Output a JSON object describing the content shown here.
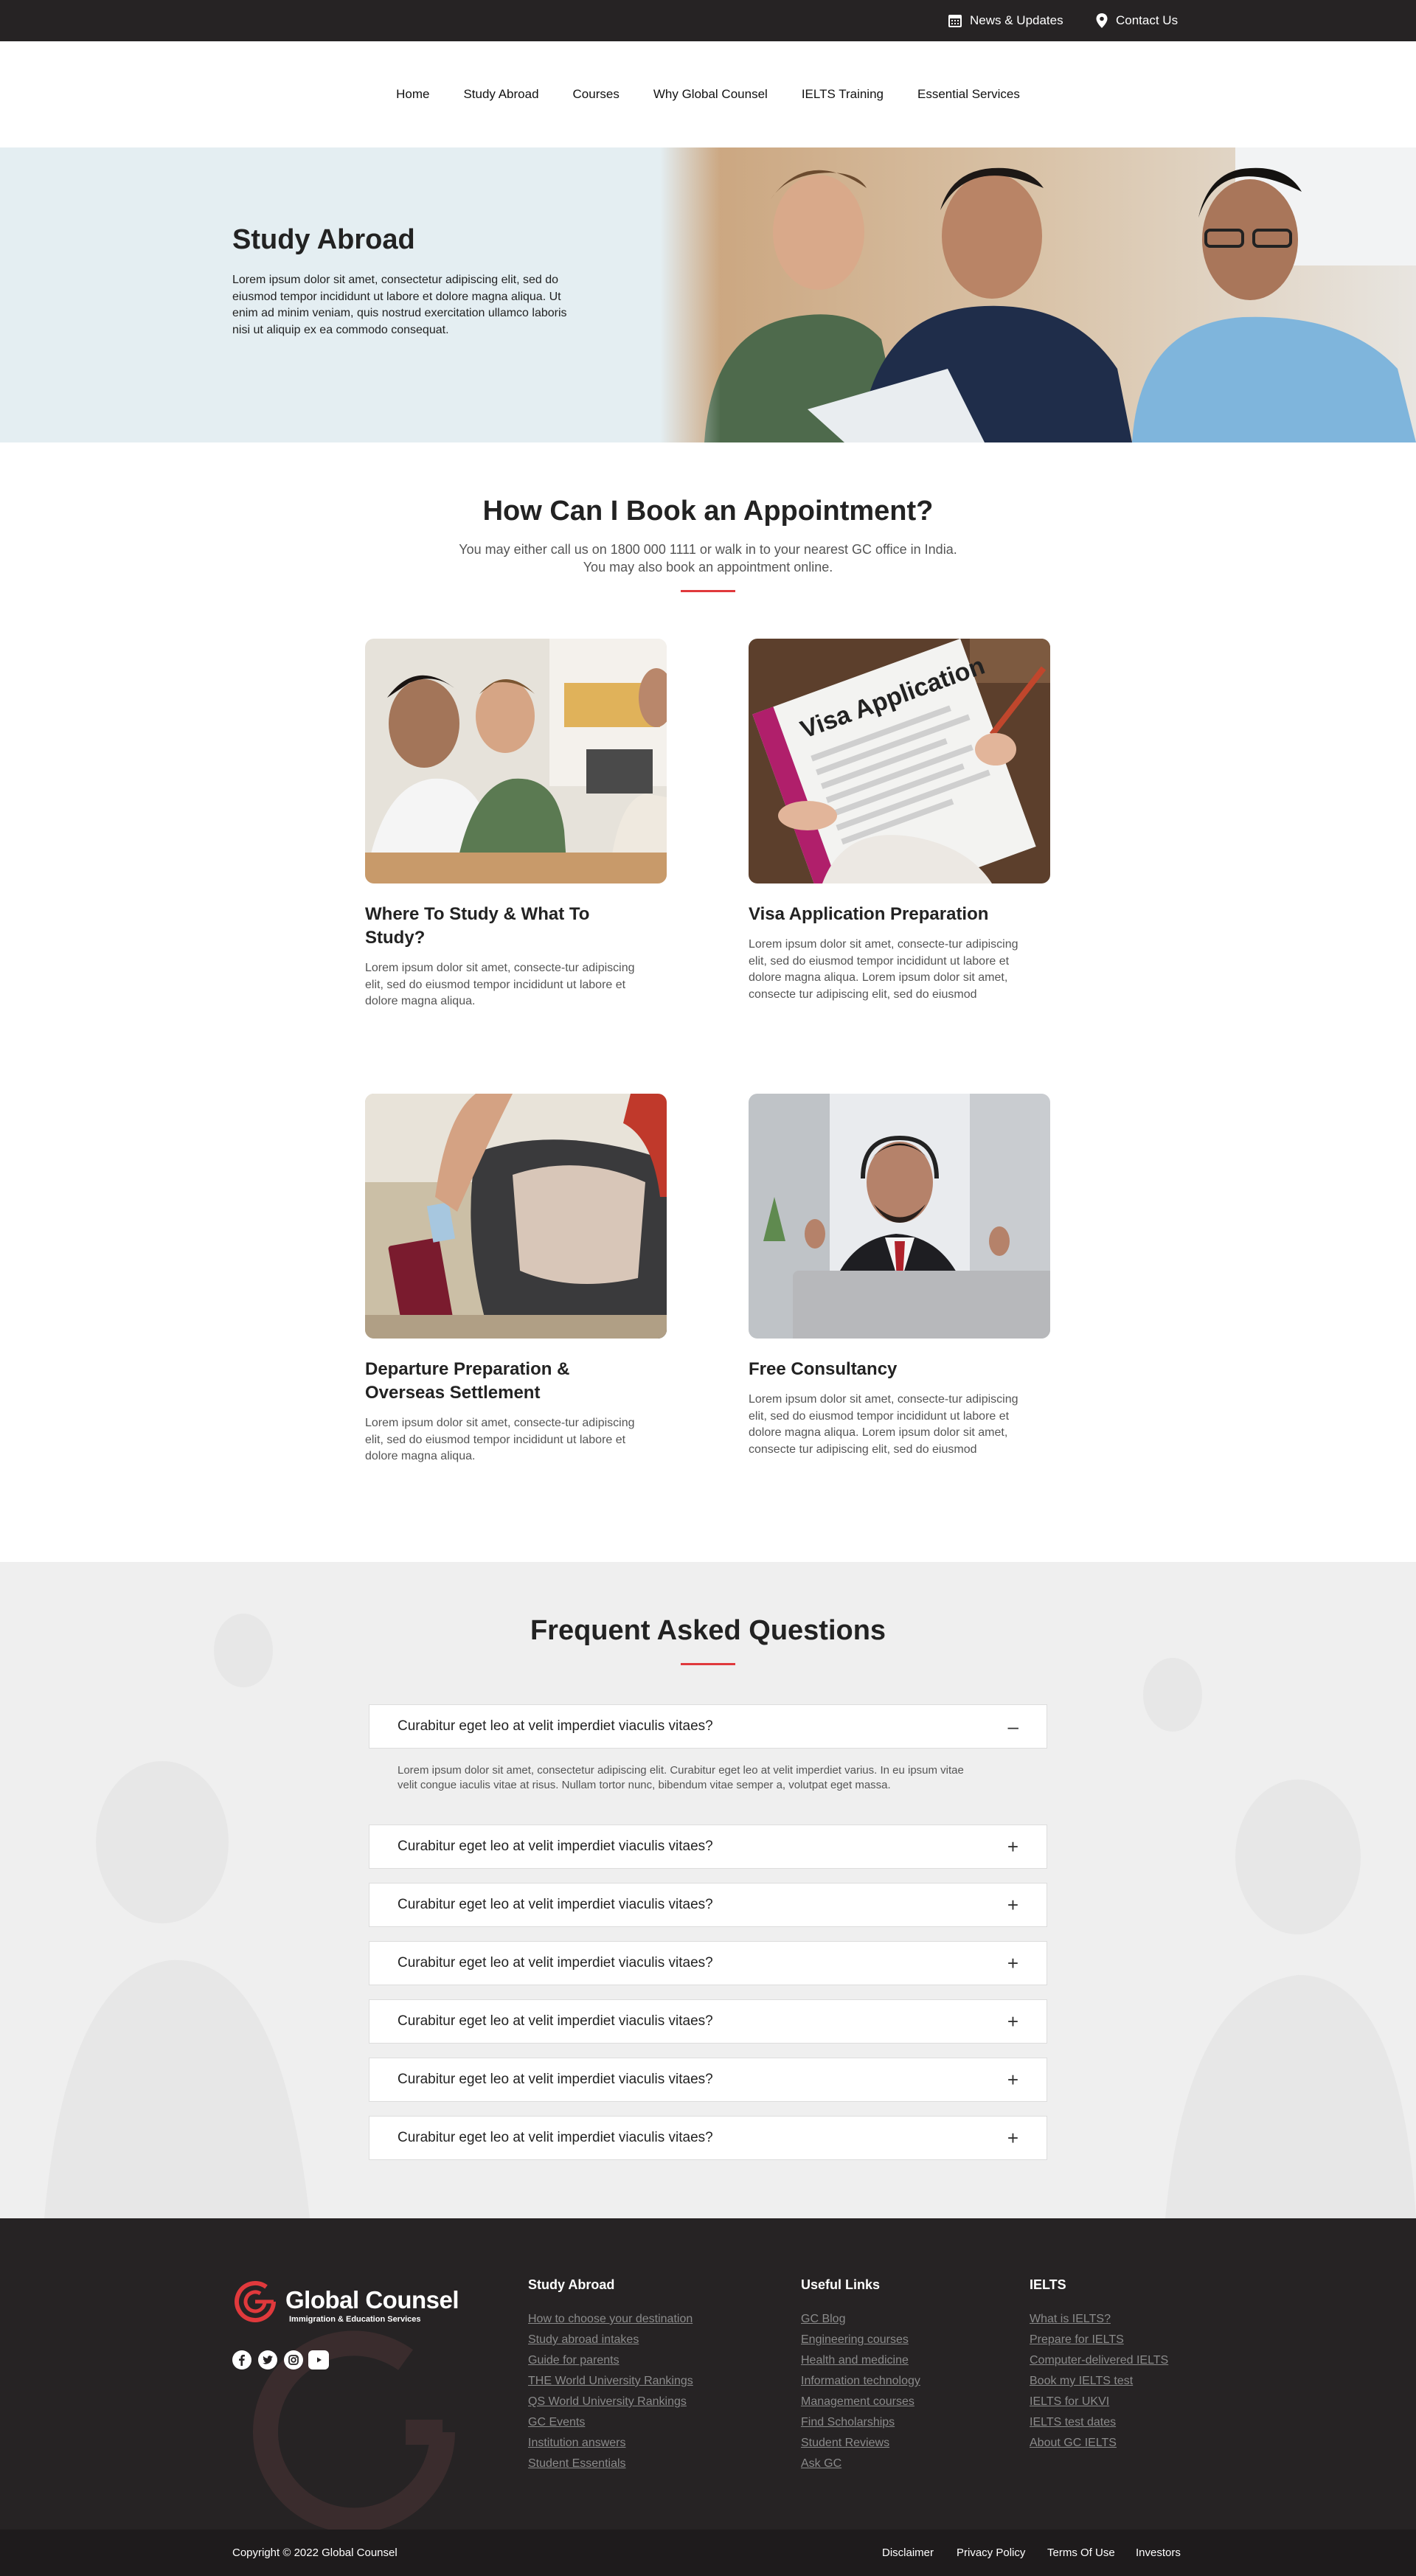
{
  "topbar": {
    "news": "News & Updates",
    "contact": "Contact Us"
  },
  "nav": [
    "Home",
    "Study Abroad",
    "Courses",
    "Why Global Counsel",
    "IELTS Training",
    "Essential Services"
  ],
  "hero": {
    "title": "Study Abroad",
    "text": "Lorem ipsum dolor sit amet, consectetur adipiscing elit, sed do eiusmod tempor incididunt ut labore et dolore magna aliqua. Ut enim ad minim veniam, quis nostrud exercitation ullamco laboris nisi ut aliquip ex ea commodo consequat."
  },
  "booking": {
    "title": "How Can I Book an Appointment?",
    "subtitle": "You may either call us on 1800 000 1111 or walk in to your nearest GC office in India. You may also book an appointment online."
  },
  "cards": [
    {
      "title": "Where To Study & What To Study?",
      "text": "Lorem ipsum dolor sit amet, consecte-tur adipiscing elit, sed do eiusmod tempor incididunt ut labore et dolore magna aliqua."
    },
    {
      "title": "Visa Application Preparation",
      "text": "Lorem ipsum dolor sit amet, consecte-tur adipiscing elit, sed do eiusmod tempor incididunt ut labore et dolore magna aliqua. Lorem ipsum dolor sit amet, consecte tur adipiscing elit, sed do eiusmod"
    },
    {
      "title": "Departure Preparation & Overseas Settlement",
      "text": "Lorem ipsum dolor sit amet, consecte-tur adipiscing elit, sed do eiusmod tempor incididunt ut labore et dolore magna aliqua."
    },
    {
      "title": "Free Consultancy",
      "text": "Lorem ipsum dolor sit amet, consecte-tur adipiscing elit, sed do eiusmod tempor incididunt ut labore et dolore magna aliqua. Lorem ipsum dolor sit amet, consecte tur adipiscing elit, sed do eiusmod"
    }
  ],
  "card_image_labels": {
    "visa_form": "Visa Application"
  },
  "faq": {
    "title": "Frequent Asked Questions",
    "answer": "Lorem ipsum dolor sit amet, consectetur adipiscing elit. Curabitur eget leo at velit imperdiet varius. In eu ipsum vitae velit congue iaculis vitae at risus. Nullam tortor nunc, bibendum vitae semper a, volutpat eget massa.",
    "items": [
      {
        "q": "Curabitur eget leo at velit imperdiet viaculis vitaes?",
        "sym": "–"
      },
      {
        "q": "Curabitur eget leo at velit imperdiet viaculis vitaes?",
        "sym": "+"
      },
      {
        "q": "Curabitur eget leo at velit imperdiet viaculis vitaes?",
        "sym": "+"
      },
      {
        "q": "Curabitur eget leo at velit imperdiet viaculis vitaes?",
        "sym": "+"
      },
      {
        "q": "Curabitur eget leo at velit imperdiet viaculis vitaes?",
        "sym": "+"
      },
      {
        "q": "Curabitur eget leo at velit imperdiet viaculis vitaes?",
        "sym": "+"
      },
      {
        "q": "Curabitur eget leo at velit imperdiet viaculis vitaes?",
        "sym": "+"
      }
    ]
  },
  "footer": {
    "brand": "Global Counsel",
    "tagline": "Immigration & Education Services",
    "columns": [
      {
        "title": "Study Abroad",
        "links": [
          "How to choose your destination",
          "Study abroad intakes",
          "Guide for parents",
          "THE World University Rankings",
          "QS World University Rankings",
          "GC Events",
          "Institution answers",
          "Student Essentials"
        ]
      },
      {
        "title": "Useful Links",
        "links": [
          "GC Blog",
          "Engineering courses",
          "Health and medicine",
          "Information technology",
          "Management courses",
          "Find Scholarships",
          "Student Reviews",
          "Ask GC"
        ]
      },
      {
        "title": "IELTS",
        "links": [
          "What is IELTS?",
          "Prepare for IELTS",
          "Computer-delivered IELTS",
          "Book my IELTS test",
          "IELTS for UKVI",
          "IELTS test dates",
          "About GC IELTS"
        ]
      }
    ],
    "social": [
      "facebook-icon",
      "twitter-icon",
      "instagram-icon",
      "youtube-icon"
    ]
  },
  "bottom": {
    "copyright": "Copyright © 2022 Global Counsel",
    "links": [
      "Disclaimer",
      "Privacy Policy",
      "Terms Of Use",
      "Investors"
    ]
  },
  "colors": {
    "accent": "#e0393c",
    "dark": "#262324",
    "hero_bg": "#e4eef2",
    "faq_bg": "#f0f0f0"
  }
}
